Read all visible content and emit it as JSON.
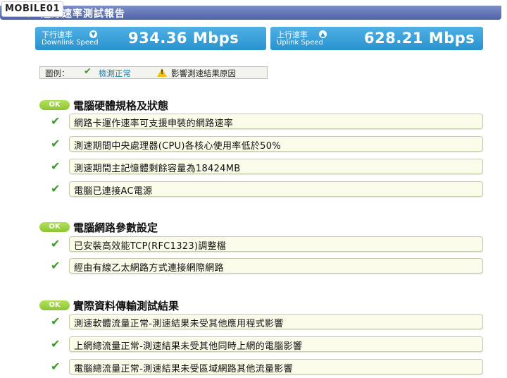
{
  "brand": {
    "text": "MOBILE01"
  },
  "header": {
    "title": "連線速率測試報告"
  },
  "downlink": {
    "label_cn": "下行速率",
    "label_en": "Downlink Speed",
    "value": "934.36 Mbps",
    "icon": "down-arrow-icon"
  },
  "uplink": {
    "label_cn": "上行速率",
    "label_en": "Uplink Speed",
    "value": "628.21 Mbps",
    "icon": "up-arrow-icon"
  },
  "legend": {
    "label": "圖例：",
    "ok_text": "檢測正常",
    "warn_text": "影響測速結果原因"
  },
  "sections": [
    {
      "badge": "OK",
      "title": "電腦硬體規格及狀態",
      "items": [
        "網路卡運作速率可支援申裝的網路速率",
        "測速期間中央處理器(CPU)各核心使用率低於50%",
        "測速期間主記憶體剩餘容量為18424MB",
        "電腦已連接AC電源"
      ]
    },
    {
      "badge": "OK",
      "title": "電腦網路參數設定",
      "items": [
        "已安裝高效能TCP(RFC1323)調整檔",
        "經由有線乙太網路方式連接網際網路"
      ]
    },
    {
      "badge": "OK",
      "title": "實際資料傳輸測試結果",
      "items": [
        "測速軟體流量正常-測速結果未受其他應用程式影響",
        "上網總流量正常-測速結果未受其他同時上網的電腦影響",
        "電腦總流量正常-測速結果未受區域網路其他流量影響"
      ]
    }
  ],
  "colors": {
    "accent": "#2993cf",
    "ok": "#8cc534",
    "header": "#4d62a8",
    "check": "#3e9b2c"
  }
}
